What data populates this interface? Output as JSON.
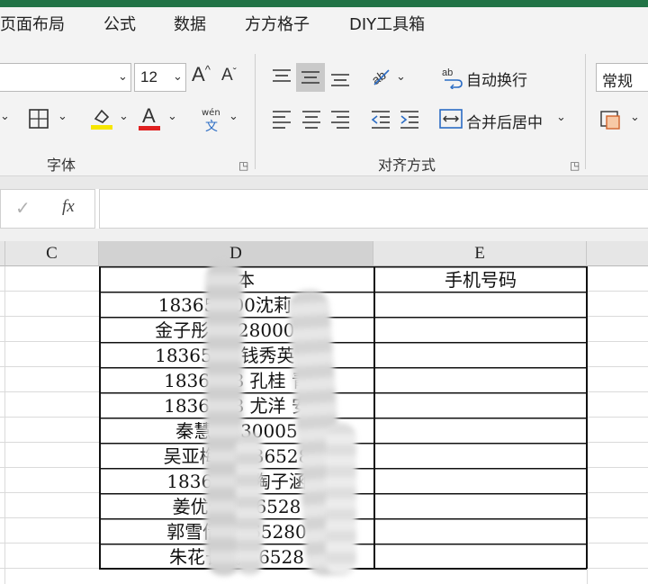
{
  "menu": {
    "items": [
      "页面布局",
      "公式",
      "数据",
      "方方格子",
      "DIY工具箱"
    ]
  },
  "ribbon": {
    "font_size_value": "12",
    "grow_font_icon": "A^",
    "shrink_font_icon": "A˅",
    "phonetic_top": "wén",
    "phonetic_bottom": "文",
    "wrap_text_label": "自动换行",
    "merge_center_label": "合并后居中",
    "font_group_label": "字体",
    "alignment_group_label": "对齐方式",
    "number_format_value": "常规",
    "highlight_color": "#f6e600",
    "font_color": "#e02020"
  },
  "formula_bar": {
    "cancel_icon": "✓",
    "fx_label": "fx",
    "formula_value": ""
  },
  "columns": [
    "C",
    "D",
    "E"
  ],
  "table": {
    "header_d": "文本",
    "header_e": "手机号码",
    "rows": [
      "183652 00沈莉 嘉",
      "金子彤1 528000 涛",
      "1836528 钱秀英 丽",
      "1836528 孔桂 青",
      "1836528 尤洋 安",
      "秦慧18 30005",
      "吴亚梅王 336528",
      "1836528 陶子涵",
      "姜优优 336528",
      "郭雪倩 3365280",
      "朱花长钱 36528"
    ]
  }
}
